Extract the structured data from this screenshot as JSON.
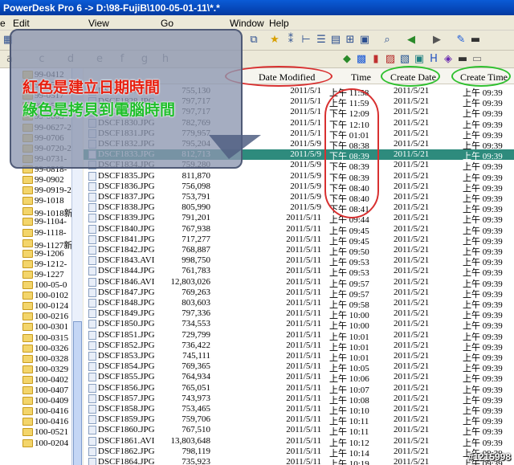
{
  "window": {
    "title": "PowerDesk Pro 6  -> D:\\98-FujiB\\100-05-01-11\\*.*"
  },
  "menu": {
    "items": [
      "e",
      "Edit",
      "View",
      "Go",
      "Window",
      "Help"
    ]
  },
  "toolbar2": {
    "drive_labels": [
      "a",
      "c",
      "d",
      "e",
      "f",
      "g",
      "h"
    ]
  },
  "tree": {
    "items": [
      "99-0412",
      "99-0502",
      "99-0517",
      "99-0531",
      "99-0603",
      "99-0627-2",
      "99-0706",
      "99-0720-2",
      "99-0731-",
      "99-0818-",
      "99-0902",
      "99-0919-2",
      "99-1018",
      "99-1018新",
      "99-1104-",
      "99-1118-",
      "99-1127新",
      "99-1206",
      "99-1212-",
      "99-1227",
      "100-05-0",
      "100-0102",
      "100-0124",
      "100-0216",
      "100-0301",
      "100-0315",
      "100-0326",
      "100-0328",
      "100-0329",
      "100-0402",
      "100-0407",
      "100-0409",
      "100-0416",
      "100-0416",
      "100-0521",
      "100-0204"
    ]
  },
  "columns": {
    "date_modified": "Date Modified",
    "time": "Time",
    "create_date": "Create Date",
    "create_time": "Create Time"
  },
  "annotations": {
    "red_note": "紅色是建立日期時間",
    "green_note": "綠色是拷貝到電腦時間"
  },
  "files": [
    {
      "name": "DSCF1827.JPG",
      "size": "755,130",
      "date": "2011/5/1",
      "time": "上午 11:58",
      "cdate": "2011/5/21",
      "ctime": "上午 09:39"
    },
    {
      "name": "DSCF1828.JPG",
      "size": "797,717",
      "date": "2011/5/1",
      "time": "上午 11:59",
      "cdate": "2011/5/21",
      "ctime": "上午 09:39"
    },
    {
      "name": "DSCF1829.JPG",
      "size": "797,717",
      "date": "2011/5/1",
      "time": "下午 12:09",
      "cdate": "2011/5/21",
      "ctime": "上午 09:39"
    },
    {
      "name": "DSCF1830.JPG",
      "size": "782,769",
      "date": "2011/5/1",
      "time": "下午 12:10",
      "cdate": "2011/5/21",
      "ctime": "上午 09:39"
    },
    {
      "name": "DSCF1831.JPG",
      "size": "779,957",
      "date": "2011/5/1",
      "time": "下午 01:01",
      "cdate": "2011/5/21",
      "ctime": "上午 09:39"
    },
    {
      "name": "DSCF1832.JPG",
      "size": "795,204",
      "date": "2011/5/9",
      "time": "下午 08:38",
      "cdate": "2011/5/21",
      "ctime": "上午 09:39"
    },
    {
      "name": "DSCF1833.JPG",
      "size": "812,713",
      "date": "2011/5/9",
      "time": "下午 08:39",
      "cdate": "2011/5/21",
      "ctime": "上午 09:39"
    },
    {
      "name": "DSCF1834.JPG",
      "size": "759,280",
      "date": "2011/5/9",
      "time": "下午 08:39",
      "cdate": "2011/5/21",
      "ctime": "上午 09:39"
    },
    {
      "name": "DSCF1835.JPG",
      "size": "811,870",
      "date": "2011/5/9",
      "time": "下午 08:39",
      "cdate": "2011/5/21",
      "ctime": "上午 09:39"
    },
    {
      "name": "DSCF1836.JPG",
      "size": "756,098",
      "date": "2011/5/9",
      "time": "下午 08:40",
      "cdate": "2011/5/21",
      "ctime": "上午 09:39"
    },
    {
      "name": "DSCF1837.JPG",
      "size": "753,791",
      "date": "2011/5/9",
      "time": "下午 08:40",
      "cdate": "2011/5/21",
      "ctime": "上午 09:39"
    },
    {
      "name": "DSCF1838.JPG",
      "size": "805,990",
      "date": "2011/5/9",
      "time": "下午 08:41",
      "cdate": "2011/5/21",
      "ctime": "上午 09:39"
    },
    {
      "name": "DSCF1839.JPG",
      "size": "791,201",
      "date": "2011/5/11",
      "time": "上午 09:44",
      "cdate": "2011/5/21",
      "ctime": "上午 09:39"
    },
    {
      "name": "DSCF1840.JPG",
      "size": "767,938",
      "date": "2011/5/11",
      "time": "上午 09:45",
      "cdate": "2011/5/21",
      "ctime": "上午 09:39"
    },
    {
      "name": "DSCF1841.JPG",
      "size": "717,277",
      "date": "2011/5/11",
      "time": "上午 09:45",
      "cdate": "2011/5/21",
      "ctime": "上午 09:39"
    },
    {
      "name": "DSCF1842.JPG",
      "size": "768,887",
      "date": "2011/5/11",
      "time": "上午 09:50",
      "cdate": "2011/5/21",
      "ctime": "上午 09:39"
    },
    {
      "name": "DSCF1843.AVI",
      "size": "998,750",
      "date": "2011/5/11",
      "time": "上午 09:53",
      "cdate": "2011/5/21",
      "ctime": "上午 09:39"
    },
    {
      "name": "DSCF1844.JPG",
      "size": "761,783",
      "date": "2011/5/11",
      "time": "上午 09:53",
      "cdate": "2011/5/21",
      "ctime": "上午 09:39"
    },
    {
      "name": "DSCF1846.AVI",
      "size": "12,803,026",
      "date": "2011/5/11",
      "time": "上午 09:57",
      "cdate": "2011/5/21",
      "ctime": "上午 09:39"
    },
    {
      "name": "DSCF1847.JPG",
      "size": "769,263",
      "date": "2011/5/11",
      "time": "上午 09:57",
      "cdate": "2011/5/21",
      "ctime": "上午 09:39"
    },
    {
      "name": "DSCF1848.JPG",
      "size": "803,603",
      "date": "2011/5/11",
      "time": "上午 09:58",
      "cdate": "2011/5/21",
      "ctime": "上午 09:39"
    },
    {
      "name": "DSCF1849.JPG",
      "size": "797,336",
      "date": "2011/5/11",
      "time": "上午 10:00",
      "cdate": "2011/5/21",
      "ctime": "上午 09:39"
    },
    {
      "name": "DSCF1850.JPG",
      "size": "734,553",
      "date": "2011/5/11",
      "time": "上午 10:00",
      "cdate": "2011/5/21",
      "ctime": "上午 09:39"
    },
    {
      "name": "DSCF1851.JPG",
      "size": "729,799",
      "date": "2011/5/11",
      "time": "上午 10:01",
      "cdate": "2011/5/21",
      "ctime": "上午 09:39"
    },
    {
      "name": "DSCF1852.JPG",
      "size": "736,422",
      "date": "2011/5/11",
      "time": "上午 10:01",
      "cdate": "2011/5/21",
      "ctime": "上午 09:39"
    },
    {
      "name": "DSCF1853.JPG",
      "size": "745,111",
      "date": "2011/5/11",
      "time": "上午 10:01",
      "cdate": "2011/5/21",
      "ctime": "上午 09:39"
    },
    {
      "name": "DSCF1854.JPG",
      "size": "769,365",
      "date": "2011/5/11",
      "time": "上午 10:05",
      "cdate": "2011/5/21",
      "ctime": "上午 09:39"
    },
    {
      "name": "DSCF1855.JPG",
      "size": "764,934",
      "date": "2011/5/11",
      "time": "上午 10:06",
      "cdate": "2011/5/21",
      "ctime": "上午 09:39"
    },
    {
      "name": "DSCF1856.JPG",
      "size": "765,051",
      "date": "2011/5/11",
      "time": "上午 10:07",
      "cdate": "2011/5/21",
      "ctime": "上午 09:39"
    },
    {
      "name": "DSCF1857.JPG",
      "size": "743,973",
      "date": "2011/5/11",
      "time": "上午 10:08",
      "cdate": "2011/5/21",
      "ctime": "上午 09:39"
    },
    {
      "name": "DSCF1858.JPG",
      "size": "753,465",
      "date": "2011/5/11",
      "time": "上午 10:10",
      "cdate": "2011/5/21",
      "ctime": "上午 09:39"
    },
    {
      "name": "DSCF1859.JPG",
      "size": "759,706",
      "date": "2011/5/11",
      "time": "上午 10:11",
      "cdate": "2011/5/21",
      "ctime": "上午 09:39"
    },
    {
      "name": "DSCF1860.JPG",
      "size": "767,510",
      "date": "2011/5/11",
      "time": "上午 10:11",
      "cdate": "2011/5/21",
      "ctime": "上午 09:39"
    },
    {
      "name": "DSCF1861.AVI",
      "size": "13,803,648",
      "date": "2011/5/11",
      "time": "上午 10:12",
      "cdate": "2011/5/21",
      "ctime": "上午 09:39"
    },
    {
      "name": "DSCF1862.JPG",
      "size": "798,119",
      "date": "2011/5/11",
      "time": "上午 10:14",
      "cdate": "2011/5/21",
      "ctime": "上午 09:39"
    },
    {
      "name": "DSCF1864.JPG",
      "size": "735,923",
      "date": "2011/5/11",
      "time": "上午 10:19",
      "cdate": "2011/5/21",
      "ctime": "上午 09:39"
    }
  ],
  "watermark": "#1215998"
}
